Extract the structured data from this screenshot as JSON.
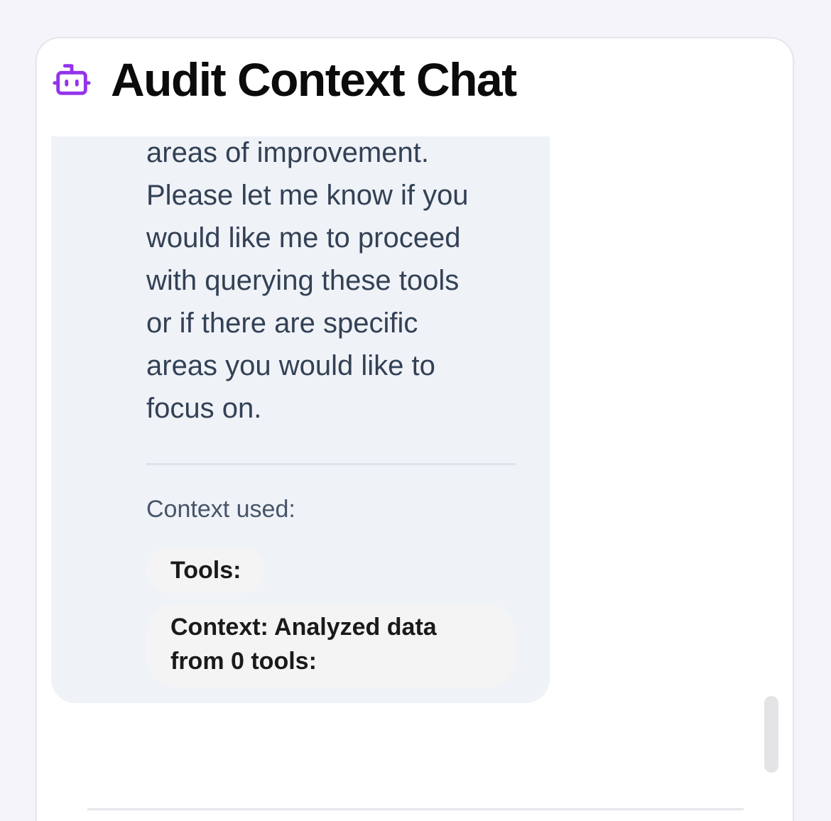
{
  "header": {
    "title": "Audit Context Chat",
    "icon": "bot-icon",
    "accent_color": "#9333ea"
  },
  "message": {
    "text": "areas of improvement.\nPlease let me know if you\nwould like me to proceed\nwith querying these tools\nor if there are specific\nareas you would like to\nfocus on.",
    "context_label": "Context used:",
    "tools_chip": "Tools:",
    "context_chip": "Context: Analyzed data from 0 tools:"
  }
}
